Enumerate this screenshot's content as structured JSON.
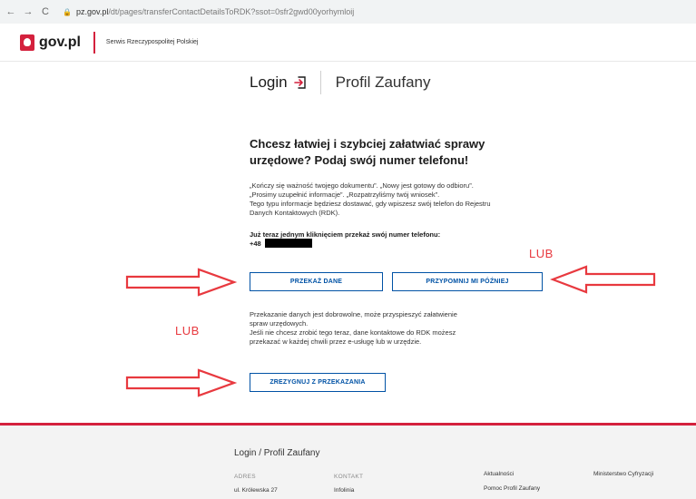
{
  "browser": {
    "back": "←",
    "forward": "→",
    "reload": "C",
    "url_host": "pz.gov.pl",
    "url_path": "/dt/pages/transferContactDetailsToRDK?ssot=0sfr2gwd00yorhymloij"
  },
  "header": {
    "logo": "gov.pl",
    "subtitle": "Serwis Rzeczypospolitej Polskiej"
  },
  "title": {
    "login": "Login",
    "service": "Profil Zaufany"
  },
  "content": {
    "headline": "Chcesz łatwiej i szybciej załatwiać sprawy urzędowe? Podaj swój numer telefonu!",
    "para1_line1": "„Kończy się ważność twojego dokumentu”. „Nowy jest gotowy do odbioru”.",
    "para1_line2": "„Prosimy uzupełnić informacje”. „Rozpatrzyliśmy twój wniosek”.",
    "para1_line3": "Tego typu informacje będziesz dostawać, gdy wpiszesz swój telefon do Rejestru",
    "para1_line4": "Danych Kontaktowych (RDK).",
    "phone_label": "Już teraz jednym kliknięciem przekaż swój numer telefonu:",
    "phone_prefix": "+48",
    "para2_line1": "Przekazanie danych jest dobrowolne, może przyspieszyć załatwienie",
    "para2_line2": "spraw urzędowych.",
    "para2_line3": "Jeśli nie chcesz zrobić tego teraz, dane kontaktowe do RDK możesz",
    "para2_line4": "przekazać w każdej chwili przez e-usługę lub w urzędzie."
  },
  "buttons": {
    "przekaz": "PRZEKAŻ DANE",
    "przypomnij": "PRZYPOMNIJ MI PÓŹNIEJ",
    "zrezygnuj": "ZREZYGNUJ Z PRZEKAZANIA"
  },
  "annotations": {
    "lub1": "LUB",
    "lub2": "LUB",
    "color": "#e8393f"
  },
  "footer": {
    "title": "Login / Profil Zaufany",
    "adres_label": "ADRES",
    "adres_value": "ul. Królewska 27",
    "kontakt_label": "KONTAKT",
    "kontakt_value": "Infolinia",
    "aktualnosci": "Aktualności",
    "pomoc": "Pomoc Profil Zaufany",
    "ministerstwo": "Ministerstwo Cyfryzacji"
  },
  "colors": {
    "accent": "#0052a5",
    "brand_red": "#d4213d"
  }
}
